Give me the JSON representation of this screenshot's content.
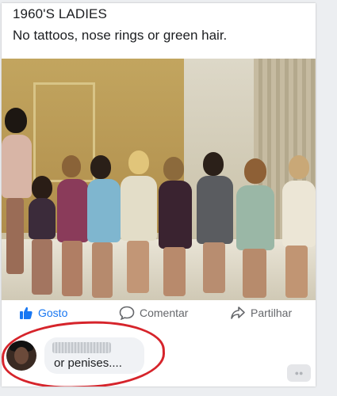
{
  "post": {
    "line1": "1960'S LADIES",
    "line2": "No tattoos, nose rings or green hair."
  },
  "actions": {
    "like_label": "Gosto",
    "comment_label": "Comentar",
    "share_label": "Partilhar"
  },
  "comment": {
    "text": "or penises...."
  },
  "colors": {
    "annotation_circle": "#d6242b",
    "like_icon": "#1877f2",
    "action_text": "#65676b"
  },
  "icons": {
    "like": "thumbs-up-icon",
    "comment": "speech-bubble-icon",
    "share": "share-arrow-icon"
  }
}
